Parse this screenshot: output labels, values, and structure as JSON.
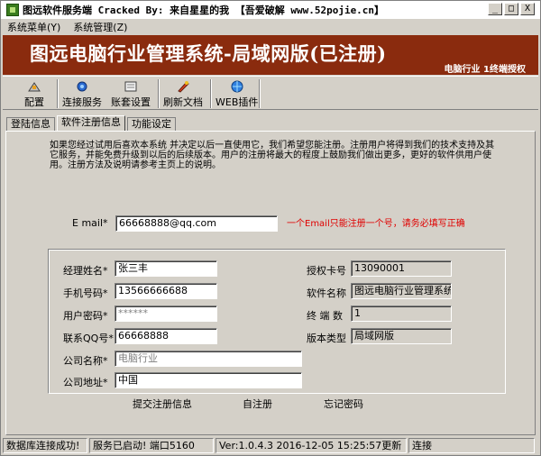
{
  "window": {
    "title": "图远软件服务端 Cracked By: 来自星星的我 【吾爱破解 www.52pojie.cn】",
    "min_label": "_",
    "max_label": "□",
    "close_label": "X"
  },
  "menu": {
    "items": [
      "系统菜单(Y)",
      "系统管理(Z)"
    ]
  },
  "banner": {
    "title": "图远电脑行业管理系统-局域网版(已注册)",
    "subtitle": "电脑行业 1终端授权",
    "bg_color": "#8a2b0e"
  },
  "toolbar": {
    "items": [
      {
        "label": "配置",
        "icon": "config-icon"
      },
      {
        "label": "连接服务",
        "icon": "connect-icon"
      },
      {
        "label": "账套设置",
        "icon": "account-set-icon"
      },
      {
        "label": "刷新文档",
        "icon": "refresh-doc-icon"
      },
      {
        "label": "WEB插件",
        "icon": "web-plugin-icon"
      }
    ]
  },
  "tabs": [
    "登陆信息",
    "软件注册信息",
    "功能设定"
  ],
  "intro": "如果您经过试用后喜欢本系统 并决定以后一直使用它，我们希望您能注册。注册用户将得到我们的技术支持及其它服务，并能免费升级到以后的后续版本。用户的注册将最大的程度上鼓励我们做出更多，更好的软件供用户使用。注册方法及说明请参考主页上的说明。",
  "email": {
    "label": "E mail*",
    "value": "66668888@qq.com",
    "hint": "一个Email只能注册一个号，请务必填写正确"
  },
  "form": {
    "manager_label": "经理姓名*",
    "manager_value": "张三丰",
    "phone_label": "手机号码*",
    "phone_value": "13566666688",
    "password_label": "用户密码*",
    "password_value": "******",
    "qq_label": "联系QQ号*",
    "qq_value": "66668888",
    "company_label": "公司名称*",
    "company_value": "电脑行业",
    "address_label": "公司地址*",
    "address_value": "中国",
    "license_label": "授权卡号",
    "license_value": "13090001",
    "software_label": "软件名称",
    "software_value": "图远电脑行业管理系统",
    "terminals_label": "终 端 数",
    "terminals_value": "1",
    "version_label": "版本类型",
    "version_value": "局域网版"
  },
  "actions": {
    "submit": "提交注册信息",
    "self_register": "自注册",
    "forgot": "忘记密码"
  },
  "status": {
    "db": "数据库连接成功!",
    "service": "服务已启动! 端口5160",
    "version": "Ver:1.0.4.3 2016-12-05 15:25:57更新",
    "conn": "连接"
  }
}
